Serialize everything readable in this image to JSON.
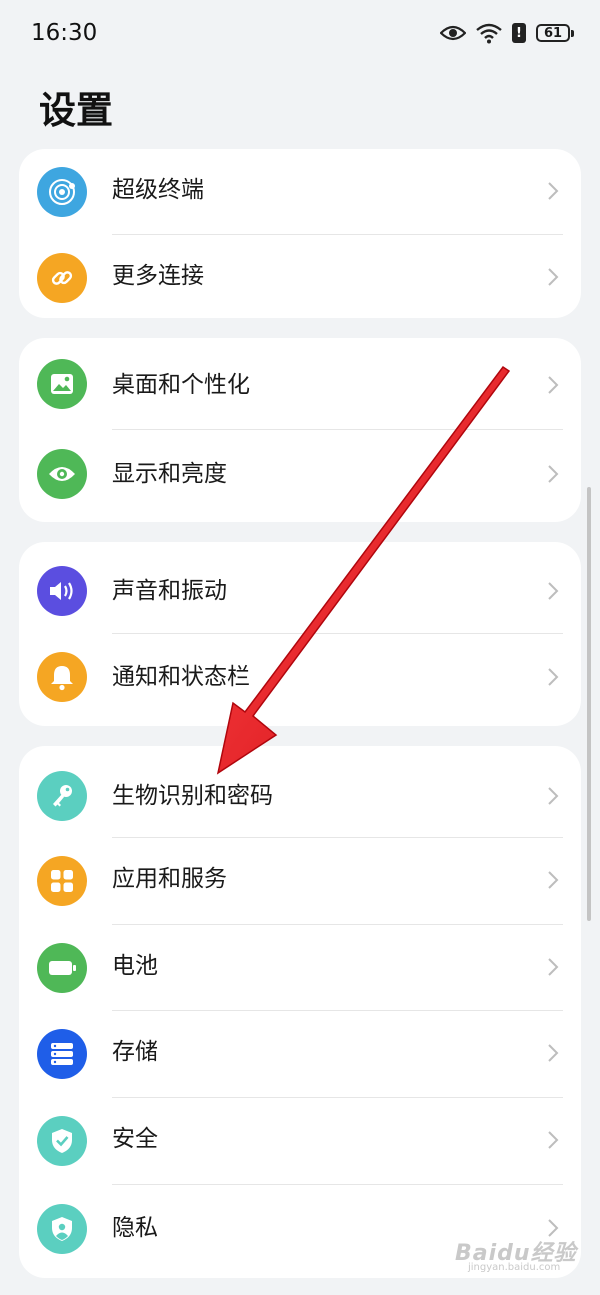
{
  "status_bar": {
    "time": "16:30",
    "battery": "61"
  },
  "page": {
    "title": "设置"
  },
  "groups": [
    {
      "items": [
        {
          "label": "超级终端",
          "icon": "super-device-icon",
          "color": "#3ea6e0"
        },
        {
          "label": "更多连接",
          "icon": "link-icon",
          "color": "#f5a623"
        }
      ]
    },
    {
      "items": [
        {
          "label": "桌面和个性化",
          "icon": "image-icon",
          "color": "#4fb857"
        },
        {
          "label": "显示和亮度",
          "icon": "eye-icon",
          "color": "#4fb857"
        }
      ]
    },
    {
      "items": [
        {
          "label": "声音和振动",
          "icon": "speaker-icon",
          "color": "#5b4ee0"
        },
        {
          "label": "通知和状态栏",
          "icon": "bell-icon",
          "color": "#f5a623"
        }
      ]
    },
    {
      "items": [
        {
          "label": "生物识别和密码",
          "icon": "key-icon",
          "color": "#5bcfc0"
        },
        {
          "label": "应用和服务",
          "icon": "apps-grid-icon",
          "color": "#f5a623"
        },
        {
          "label": "电池",
          "icon": "battery-icon",
          "color": "#4fb857"
        },
        {
          "label": "存储",
          "icon": "storage-icon",
          "color": "#1f5ee8"
        },
        {
          "label": "安全",
          "icon": "shield-check-icon",
          "color": "#5bcfc0"
        },
        {
          "label": "隐私",
          "icon": "privacy-shield-icon",
          "color": "#5bcfc0"
        }
      ]
    }
  ],
  "overlay": {
    "arrow_color": "#e3141c"
  },
  "watermark": {
    "text": "Baidu经验",
    "subtext": "jingyan.baidu.com"
  }
}
